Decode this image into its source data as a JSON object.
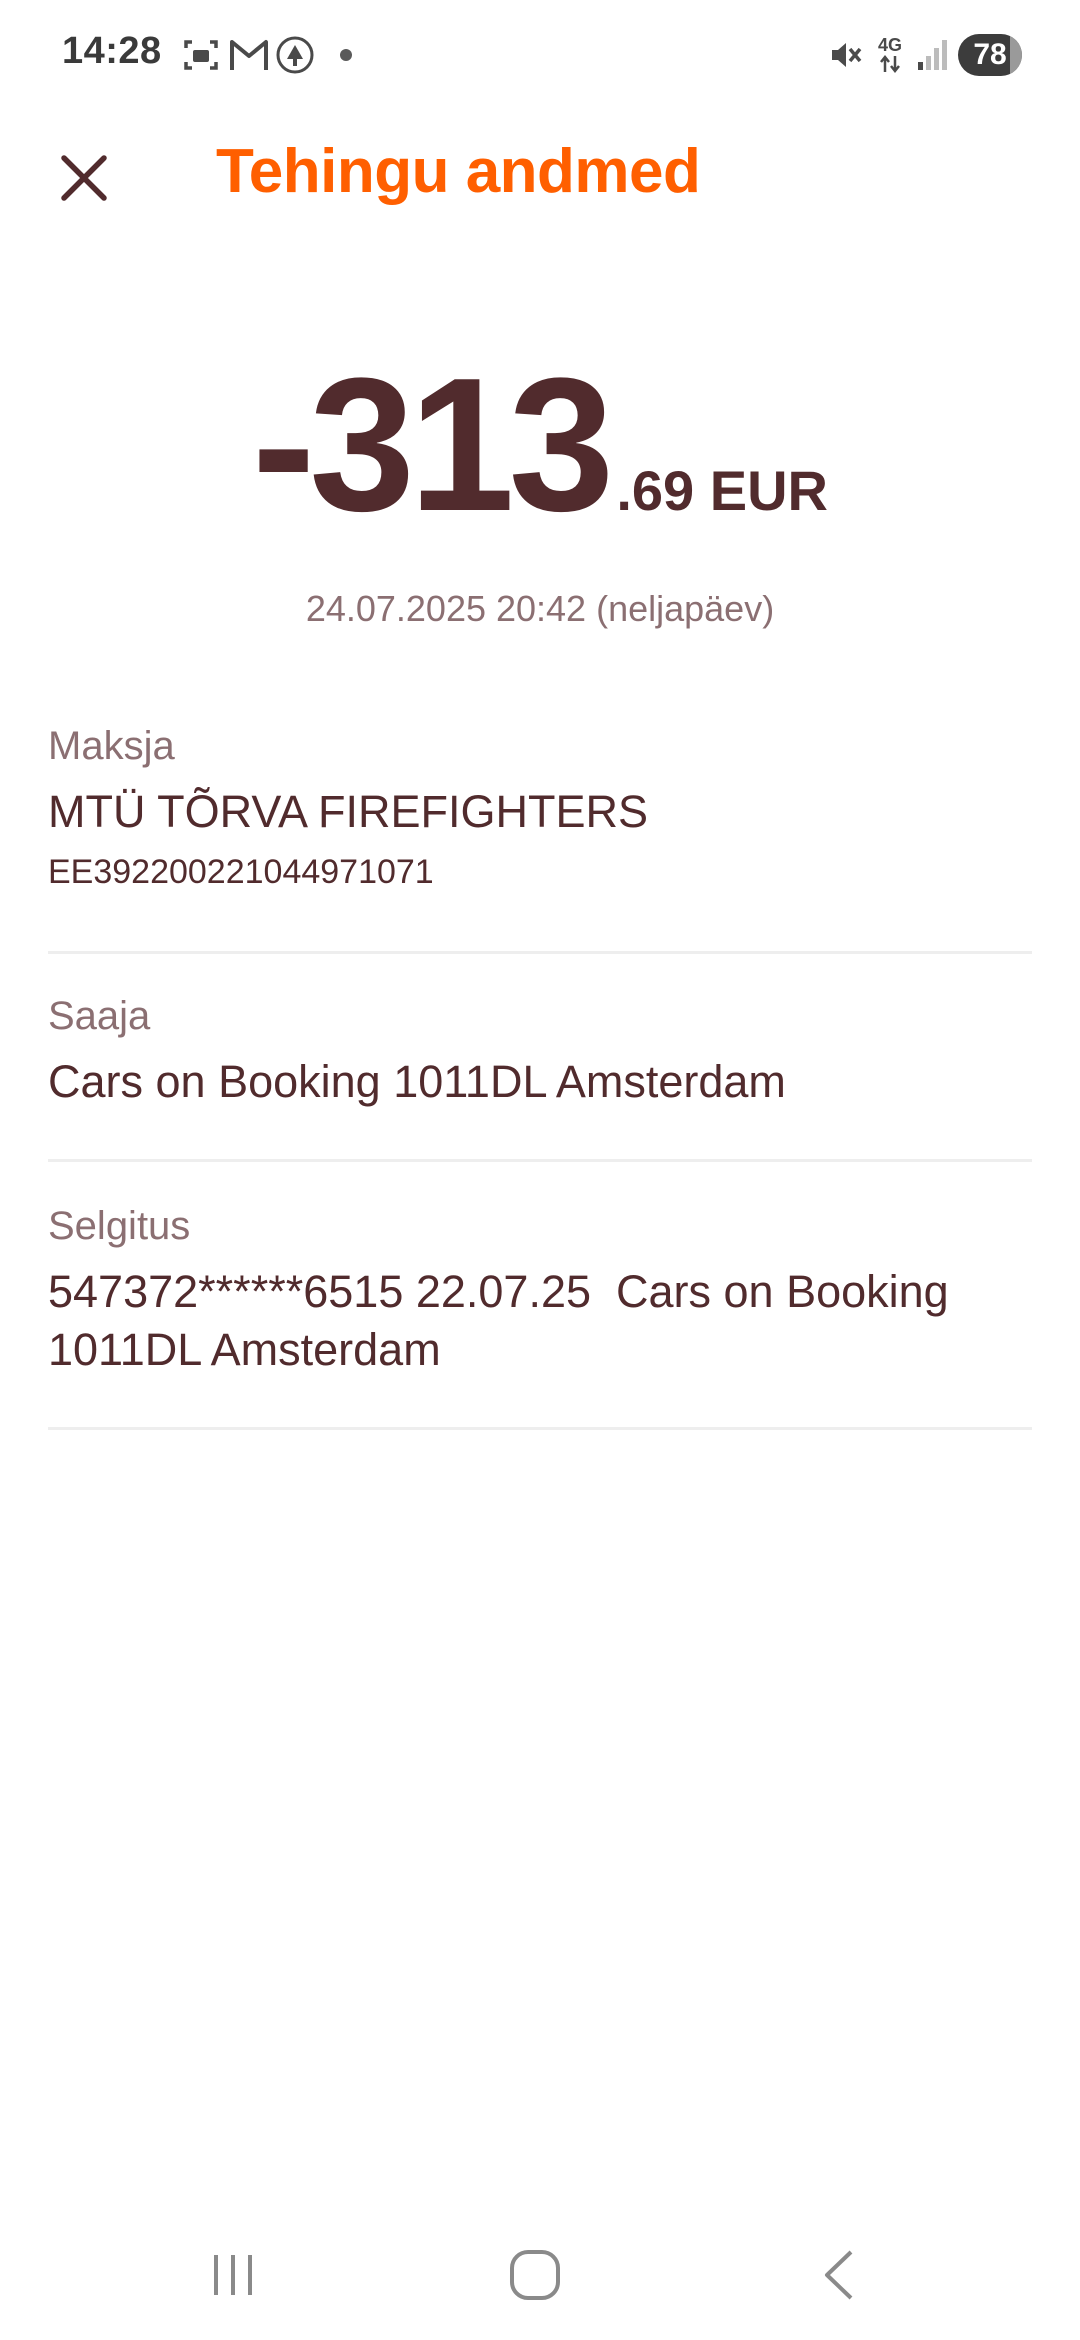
{
  "status_bar": {
    "time": "14:28",
    "battery": "78",
    "network": "4G",
    "icons": [
      "screenshot-icon",
      "gmail-icon",
      "app-icon",
      "notification-dot-icon",
      "mute-icon",
      "network-icon",
      "signal-icon"
    ]
  },
  "header": {
    "title": "Tehingu andmed",
    "close_icon": "close-icon"
  },
  "transaction": {
    "amount_integer": "-313",
    "amount_decimal": ".69 EUR",
    "datetime": "24.07.2025 20:42 (neljapäev)"
  },
  "details": {
    "payer": {
      "label": "Maksja",
      "name": "MTÜ TÕRVA FIREFIGHTERS",
      "iban": "EE392200221044971071"
    },
    "recipient": {
      "label": "Saaja",
      "name": "Cars on Booking 1011DL Amsterdam"
    },
    "description": {
      "label": "Selgitus",
      "line1": "547372******6515 22.07.25  Cars on Booking",
      "line2": "1011DL Amsterdam"
    }
  },
  "nav_bar": {
    "items": [
      "recent-apps-icon",
      "home-icon",
      "back-icon"
    ]
  },
  "colors": {
    "accent": "#ff5f00",
    "text_primary": "#512b2d",
    "text_secondary": "#8b6f72",
    "divider": "#eeeeee"
  }
}
